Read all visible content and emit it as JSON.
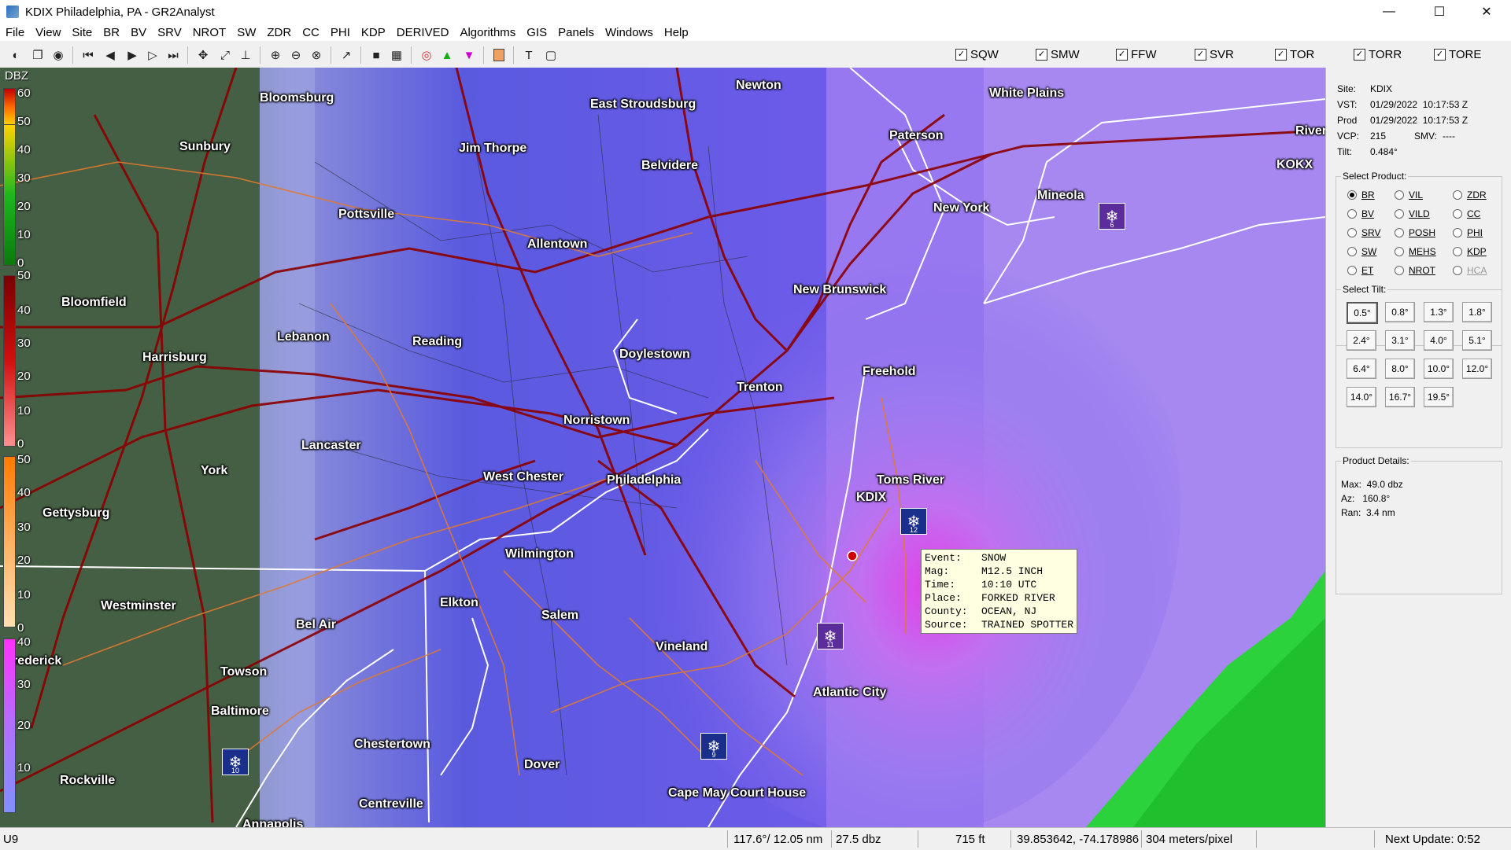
{
  "window": {
    "title": "KDIX Philadelphia, PA - GR2Analyst",
    "minimize": "—",
    "maximize": "☐",
    "close": "✕"
  },
  "menu": [
    "File",
    "View",
    "Site",
    "BR",
    "BV",
    "SRV",
    "NROT",
    "SW",
    "ZDR",
    "CC",
    "PHI",
    "KDP",
    "DERIVED",
    "Algorithms",
    "GIS",
    "Panels",
    "Windows",
    "Help"
  ],
  "warnings": [
    {
      "label": "SQW",
      "checked": true
    },
    {
      "label": "SMW",
      "checked": true
    },
    {
      "label": "FFW",
      "checked": true
    },
    {
      "label": "SVR",
      "checked": true
    },
    {
      "label": "TOR",
      "checked": true
    },
    {
      "label": "TORR",
      "checked": true
    },
    {
      "label": "TORE",
      "checked": true
    }
  ],
  "legend": {
    "title": "DBZ",
    "ticks": [
      "60",
      "50",
      "40",
      "30",
      "20",
      "10",
      "0",
      "50",
      "40",
      "30",
      "20",
      "10",
      "0",
      "50",
      "40",
      "30",
      "20",
      "10",
      "0",
      "40",
      "30",
      "20",
      "10"
    ]
  },
  "cities": [
    "Bloomsburg",
    "East Stroudsburg",
    "Newton",
    "White Plains",
    "Sunbury",
    "Jim Thorpe",
    "Paterson",
    "Belvidere",
    "Mineola",
    "KOKX",
    "River",
    "New York",
    "Pottsville",
    "Allentown",
    "New Brunswick",
    "Bloomfield",
    "Lebanon",
    "Reading",
    "Doylestown",
    "Freehold",
    "Harrisburg",
    "Trenton",
    "Norristown",
    "Lancaster",
    "Toms River",
    "KDIX",
    "York",
    "West Chester",
    "Philadelphia",
    "Gettysburg",
    "Wilmington",
    "Westminster",
    "Elkton",
    "Salem",
    "Bel Air",
    "Vineland",
    "Towson",
    "Atlantic City",
    "Baltimore",
    "Chestertown",
    "Dover",
    "Rockville",
    "Cape May Court House",
    "Centreville",
    "Annapolis",
    "rederick"
  ],
  "lsrs": [
    {
      "num": "6"
    },
    {
      "num": "12"
    },
    {
      "num": "11"
    },
    {
      "num": "9"
    },
    {
      "num": "10"
    }
  ],
  "popup": {
    "rows": [
      {
        "k": "Event:",
        "v": "SNOW"
      },
      {
        "k": "Mag:",
        "v": "M12.5 INCH"
      },
      {
        "k": "Time:",
        "v": "10:10 UTC"
      },
      {
        "k": "Place:",
        "v": "FORKED RIVER"
      },
      {
        "k": "County:",
        "v": "OCEAN, NJ"
      },
      {
        "k": "Source:",
        "v": "TRAINED SPOTTER"
      }
    ]
  },
  "panel": {
    "site_label": "Site:",
    "site": "KDIX",
    "vst_label": "VST:",
    "vst": "01/29/2022  10:17:53 Z",
    "prod_label": "Prod",
    "prod": "01/29/2022  10:17:53 Z",
    "vcp_label": "VCP:",
    "vcp": "215",
    "smv_label": "SMV:",
    "smv": "----",
    "tilt_label": "Tilt:",
    "tilt": "0.484°",
    "select_product": "Select Product:",
    "products": [
      {
        "label": "BR",
        "on": true
      },
      {
        "label": "VIL"
      },
      {
        "label": "ZDR"
      },
      {
        "label": "BV"
      },
      {
        "label": "VILD"
      },
      {
        "label": "CC"
      },
      {
        "label": "SRV"
      },
      {
        "label": "POSH"
      },
      {
        "label": "PHI"
      },
      {
        "label": "SW"
      },
      {
        "label": "MEHS"
      },
      {
        "label": "KDP"
      },
      {
        "label": "ET"
      },
      {
        "label": "NROT"
      },
      {
        "label": "HCA",
        "disabled": true
      }
    ],
    "select_tilt": "Select Tilt:",
    "tilts": [
      "0.5°",
      "0.8°",
      "1.3°",
      "1.8°",
      "2.4°",
      "3.1°",
      "4.0°",
      "5.1°",
      "6.4°",
      "8.0°",
      "10.0°",
      "12.0°",
      "14.0°",
      "16.7°",
      "19.5°"
    ],
    "product_details": "Product Details:",
    "max": "Max:  49.0 dbz",
    "az": "Az:   160.8°",
    "ran": "Ran:  3.4 nm"
  },
  "status": {
    "s1": "U9",
    "s2": "117.6°/ 12.05 nm",
    "s3": "27.5 dbz",
    "s4": "715 ft",
    "s5": "39.853642, -74.178986",
    "s6": "304 meters/pixel",
    "s7": "Next Update: 0:52"
  }
}
